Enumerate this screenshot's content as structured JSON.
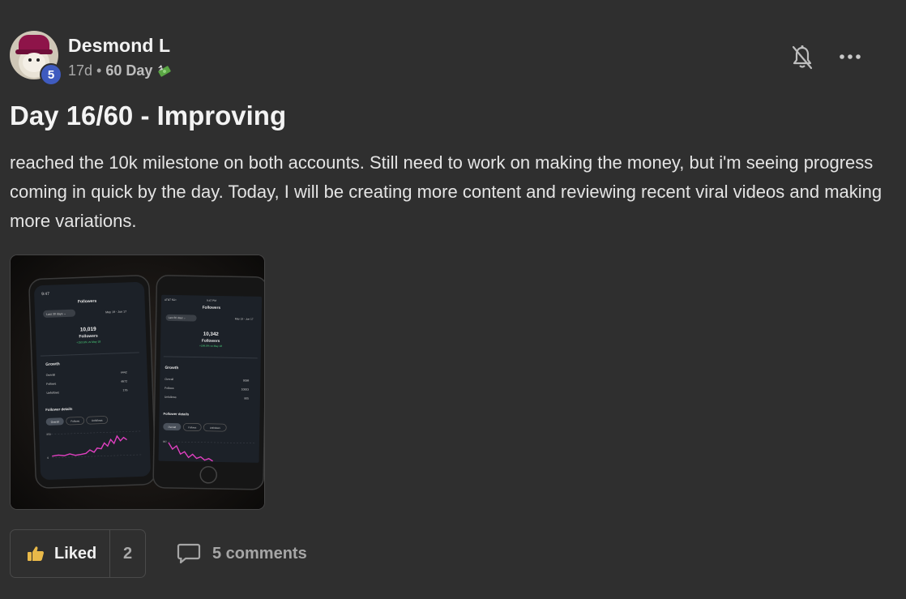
{
  "post": {
    "author": "Desmond L",
    "level": "5",
    "time_ago": "17d",
    "separator": "•",
    "category": "60 Day",
    "category_icon": "money-with-wings-icon",
    "title": "Day 16/60 - Improving",
    "body": "reached the 10k milestone on both accounts. Still need to work on making the money, but i'm seeing progress coming in quick by the day. Today, I will be creating more content and reviewing recent viral videos and making more variations."
  },
  "photo": {
    "left_phone": {
      "time": "9:47",
      "screen_title": "Followers",
      "filter": "Last 30 days ⌄",
      "date_range": "May 19 - Jun 17",
      "count": "10,019",
      "count_label": "Followers",
      "delta": "+153.6% vs May 18",
      "growth_title": "Growth",
      "rows": [
        {
          "label": "Overall",
          "value": "4442"
        },
        {
          "label": "Follows",
          "value": "4672"
        },
        {
          "label": "Unfollows",
          "value": "176"
        }
      ],
      "details_title": "Follower details",
      "chips": [
        "Overall",
        "Follows",
        "Unfollows"
      ],
      "axis_top": "350",
      "axis_bottom": "0"
    },
    "right_phone": {
      "carrier": "AT&T 5G+",
      "time": "9:47 PM",
      "screen_title": "Followers",
      "filter": "Last 30 days ⌄",
      "date_range": "May 19 - Jun 17",
      "count": "10,342",
      "count_label": "Followers",
      "delta": "+184.0% vs May 18",
      "growth_title": "Growth",
      "rows": [
        {
          "label": "Overall",
          "value": "9098"
        },
        {
          "label": "Follows",
          "value": "10003"
        },
        {
          "label": "Unfollows",
          "value": "905"
        }
      ],
      "details_title": "Follower details",
      "chips": [
        "Overall",
        "Follows",
        "Unfollows"
      ],
      "axis_top": "887"
    }
  },
  "actions": {
    "like_label": "Liked",
    "like_count": "2",
    "comments_label": "5 comments"
  },
  "colors": {
    "background": "#2f2f2f",
    "level_badge": "#3f5bbf",
    "chart_line": "#e040c0",
    "liked_icon": "#e9b949"
  },
  "icons": {
    "bell": "bell-off-icon",
    "more": "more-horizontal-icon",
    "like": "thumbs-up-icon",
    "comment": "comment-bubble-icon"
  }
}
